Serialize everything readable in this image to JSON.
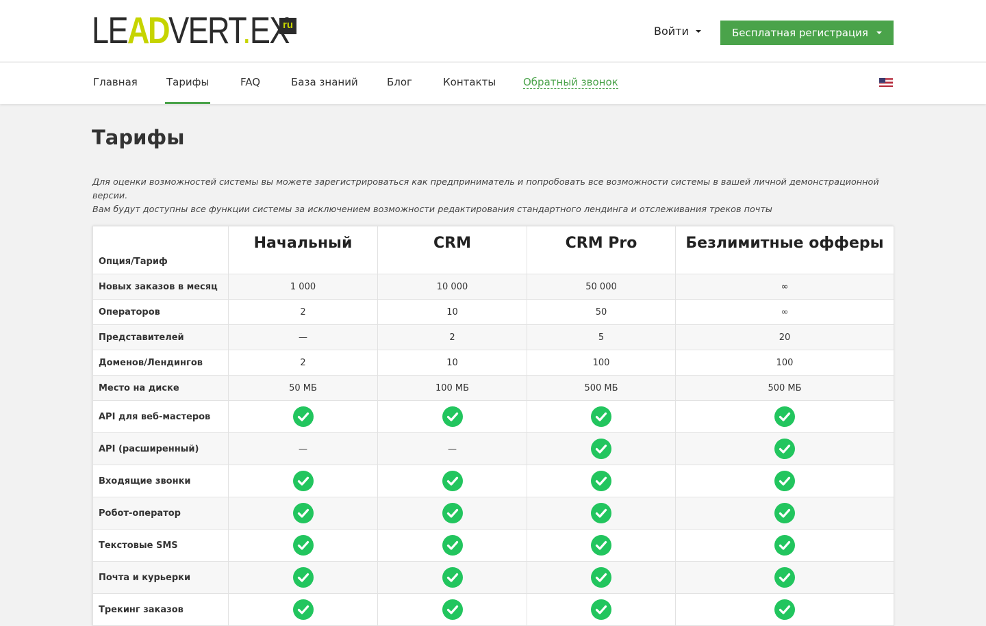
{
  "logo": {
    "part1": "LE",
    "part2": "AD",
    "part3": "VERT",
    "dot": ".",
    "part4": "EX",
    "tld": "ru"
  },
  "header": {
    "login_label": "Войти",
    "register_label": "Бесплатная регистрация"
  },
  "nav": {
    "items": [
      {
        "label": "Главная"
      },
      {
        "label": "Тарифы"
      },
      {
        "label": "FAQ"
      },
      {
        "label": "База знаний"
      },
      {
        "label": "Блог"
      },
      {
        "label": "Контакты"
      },
      {
        "label": "Обратный звонок"
      }
    ],
    "active_index": 1,
    "language_flag": "us-flag-icon"
  },
  "page": {
    "title": "Тарифы",
    "intro_line1": "Для оценки возможностей системы вы можете зарегистрироваться как предприниматель и попробовать все возможности системы в вашей личной демонстрационной версии.",
    "intro_line2": "Вам будут доступны все функции системы за исключением возможности редактирования стандартного лендинга и отслеживания треков почты"
  },
  "pricing": {
    "option_header": "Опция/Тариф",
    "plans": [
      "Начальный",
      "CRM",
      "CRM Pro",
      "Безлимитные офферы"
    ],
    "rows": [
      {
        "label": "Новых заказов в месяц",
        "type": "text",
        "values": [
          "1 000",
          "10 000",
          "50 000",
          "∞"
        ]
      },
      {
        "label": "Операторов",
        "type": "text",
        "values": [
          "2",
          "10",
          "50",
          "∞"
        ]
      },
      {
        "label": "Представителей",
        "type": "text",
        "values": [
          "—",
          "2",
          "5",
          "20"
        ]
      },
      {
        "label": "Доменов/Лендингов",
        "type": "text",
        "values": [
          "2",
          "10",
          "100",
          "100"
        ]
      },
      {
        "label": "Место на диске",
        "type": "text",
        "values": [
          "50 МБ",
          "100 МБ",
          "500 МБ",
          "500 МБ"
        ]
      },
      {
        "label": "API для веб-мастеров",
        "type": "icon",
        "values": [
          "check",
          "check",
          "check",
          "check"
        ]
      },
      {
        "label": "API (расширенный)",
        "type": "icon",
        "values": [
          "—",
          "—",
          "check",
          "check"
        ]
      },
      {
        "label": "Входящие звонки",
        "type": "icon",
        "values": [
          "check",
          "check",
          "check",
          "check"
        ]
      },
      {
        "label": "Робот-оператор",
        "type": "icon",
        "values": [
          "check",
          "check",
          "check",
          "check"
        ]
      },
      {
        "label": "Текстовые SMS",
        "type": "icon",
        "values": [
          "check",
          "check",
          "check",
          "check"
        ]
      },
      {
        "label": "Почта и курьерки",
        "type": "icon",
        "values": [
          "check",
          "check",
          "check",
          "check"
        ]
      },
      {
        "label": "Трекинг заказов",
        "type": "icon",
        "values": [
          "check",
          "check",
          "check",
          "check"
        ]
      }
    ]
  },
  "colors": {
    "accent": "#4aa34a",
    "check": "#22c55e",
    "logo_accent": "#c6d400"
  }
}
